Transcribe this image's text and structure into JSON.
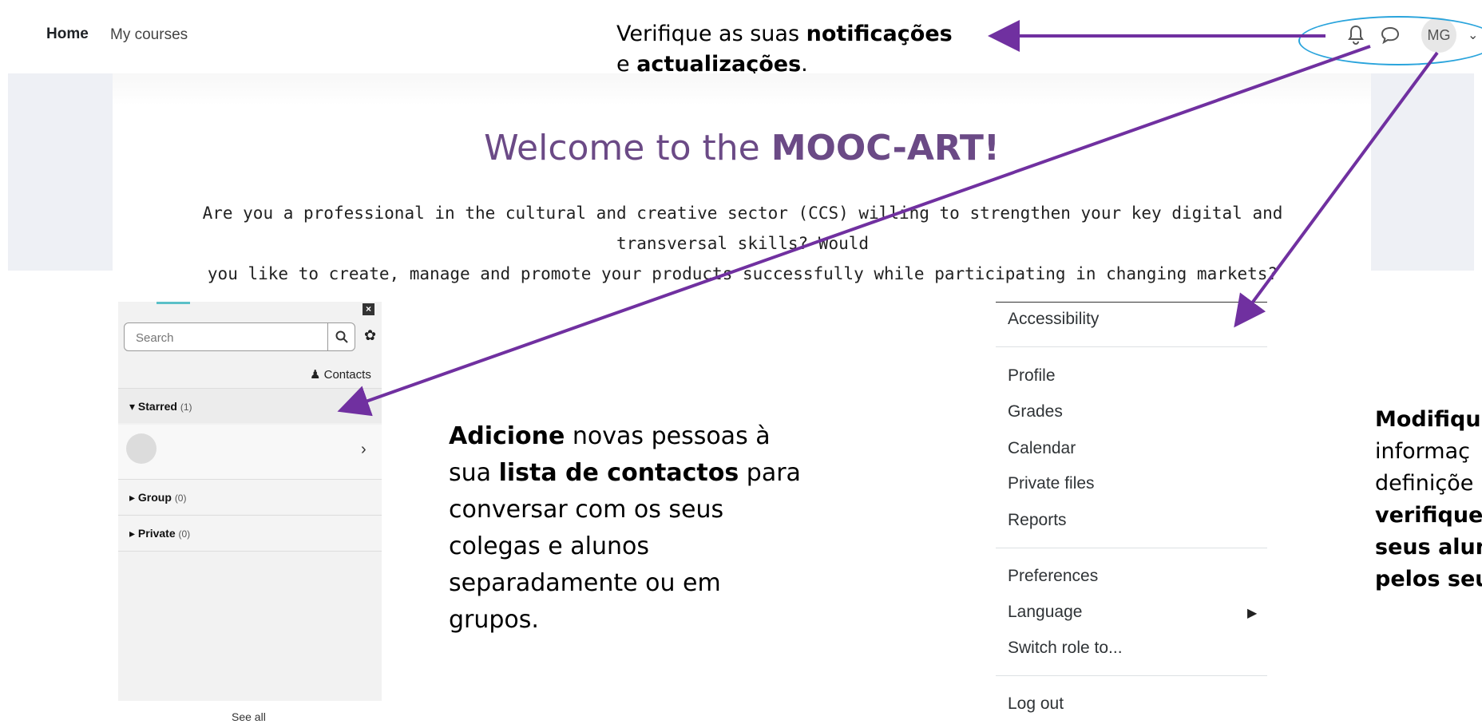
{
  "nav": {
    "home": "Home",
    "my_courses": "My courses"
  },
  "callouts": {
    "notifications": {
      "pre": "Verifique as suas ",
      "bold1": "notificações",
      "mid": " e ",
      "bold2": "actualizações",
      "post": "."
    },
    "contacts": {
      "bold1": "Adicione",
      "t1": " novas pessoas à sua ",
      "bold2": "lista de contactos",
      "t2": " para conversar com os seus colegas e alunos separadamente ou em grupos."
    },
    "profile": {
      "l1": "Modifiqu",
      "l2": "informaç",
      "l3": "definiçõe",
      "l4": "verifique",
      "l5": "seus alun",
      "l6": "pelos seu"
    }
  },
  "user": {
    "initials": "MG"
  },
  "hero": {
    "title_pre": "Welcome to the ",
    "title_bold": "MOOC-ART!",
    "line1": "Are you a professional in the cultural and creative sector (CCS) willing to strengthen your key digital and transversal skills? Would",
    "line2": "you like to create, manage and promote your products successfully while participating in changing markets?"
  },
  "messaging": {
    "search_placeholder": "Search",
    "contacts_label": "Contacts",
    "sections": [
      {
        "label": "Starred",
        "count": "(1)"
      },
      {
        "label": "Group",
        "count": "(0)"
      },
      {
        "label": "Private",
        "count": "(0)"
      }
    ],
    "see_all": "See all"
  },
  "user_menu": {
    "items": [
      "Accessibility",
      "Profile",
      "Grades",
      "Calendar",
      "Private files",
      "Reports",
      "Preferences",
      "Language",
      "Switch role to...",
      "Log out"
    ]
  },
  "colors": {
    "accent_purple": "#7030a0",
    "highlight_blue": "#2aa4dc",
    "title_purple": "#6b4a86"
  }
}
